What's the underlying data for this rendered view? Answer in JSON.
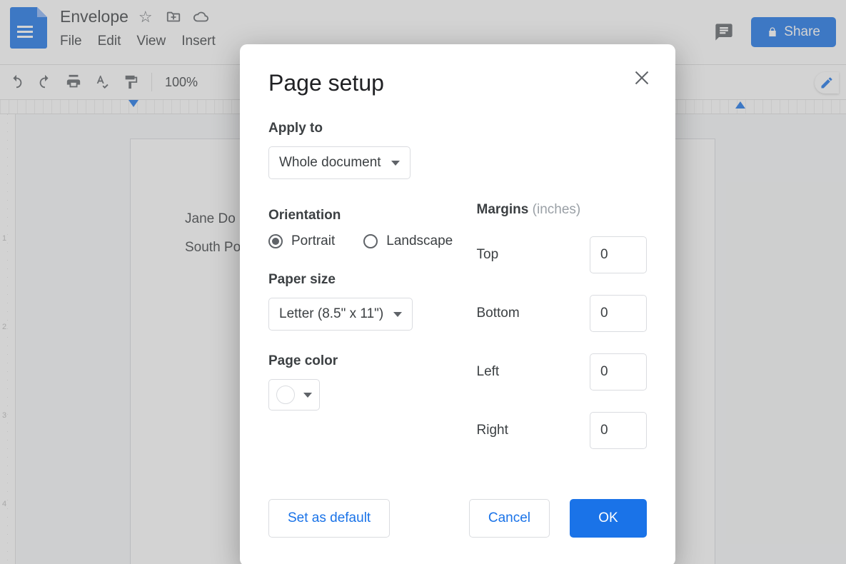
{
  "doc": {
    "title": "Envelope",
    "lines": [
      "Jane Do",
      "South Po"
    ]
  },
  "menus": [
    "File",
    "Edit",
    "View",
    "Insert"
  ],
  "share_label": "Share",
  "toolbar": {
    "zoom": "100%"
  },
  "ruler_v": [
    "1",
    "2",
    "3",
    "4"
  ],
  "dialog": {
    "title": "Page setup",
    "apply_to": {
      "label": "Apply to",
      "value": "Whole document"
    },
    "orientation": {
      "label": "Orientation",
      "options": {
        "portrait": "Portrait",
        "landscape": "Landscape"
      },
      "selected": "portrait"
    },
    "paper_size": {
      "label": "Paper size",
      "value": "Letter (8.5\" x 11\")"
    },
    "page_color": {
      "label": "Page color",
      "value": "#ffffff"
    },
    "margins": {
      "label": "Margins",
      "unit": "(inches)",
      "top": {
        "label": "Top",
        "value": "0"
      },
      "bottom": {
        "label": "Bottom",
        "value": "0"
      },
      "left": {
        "label": "Left",
        "value": "0"
      },
      "right": {
        "label": "Right",
        "value": "0"
      }
    },
    "buttons": {
      "set_default": "Set as default",
      "cancel": "Cancel",
      "ok": "OK"
    }
  }
}
